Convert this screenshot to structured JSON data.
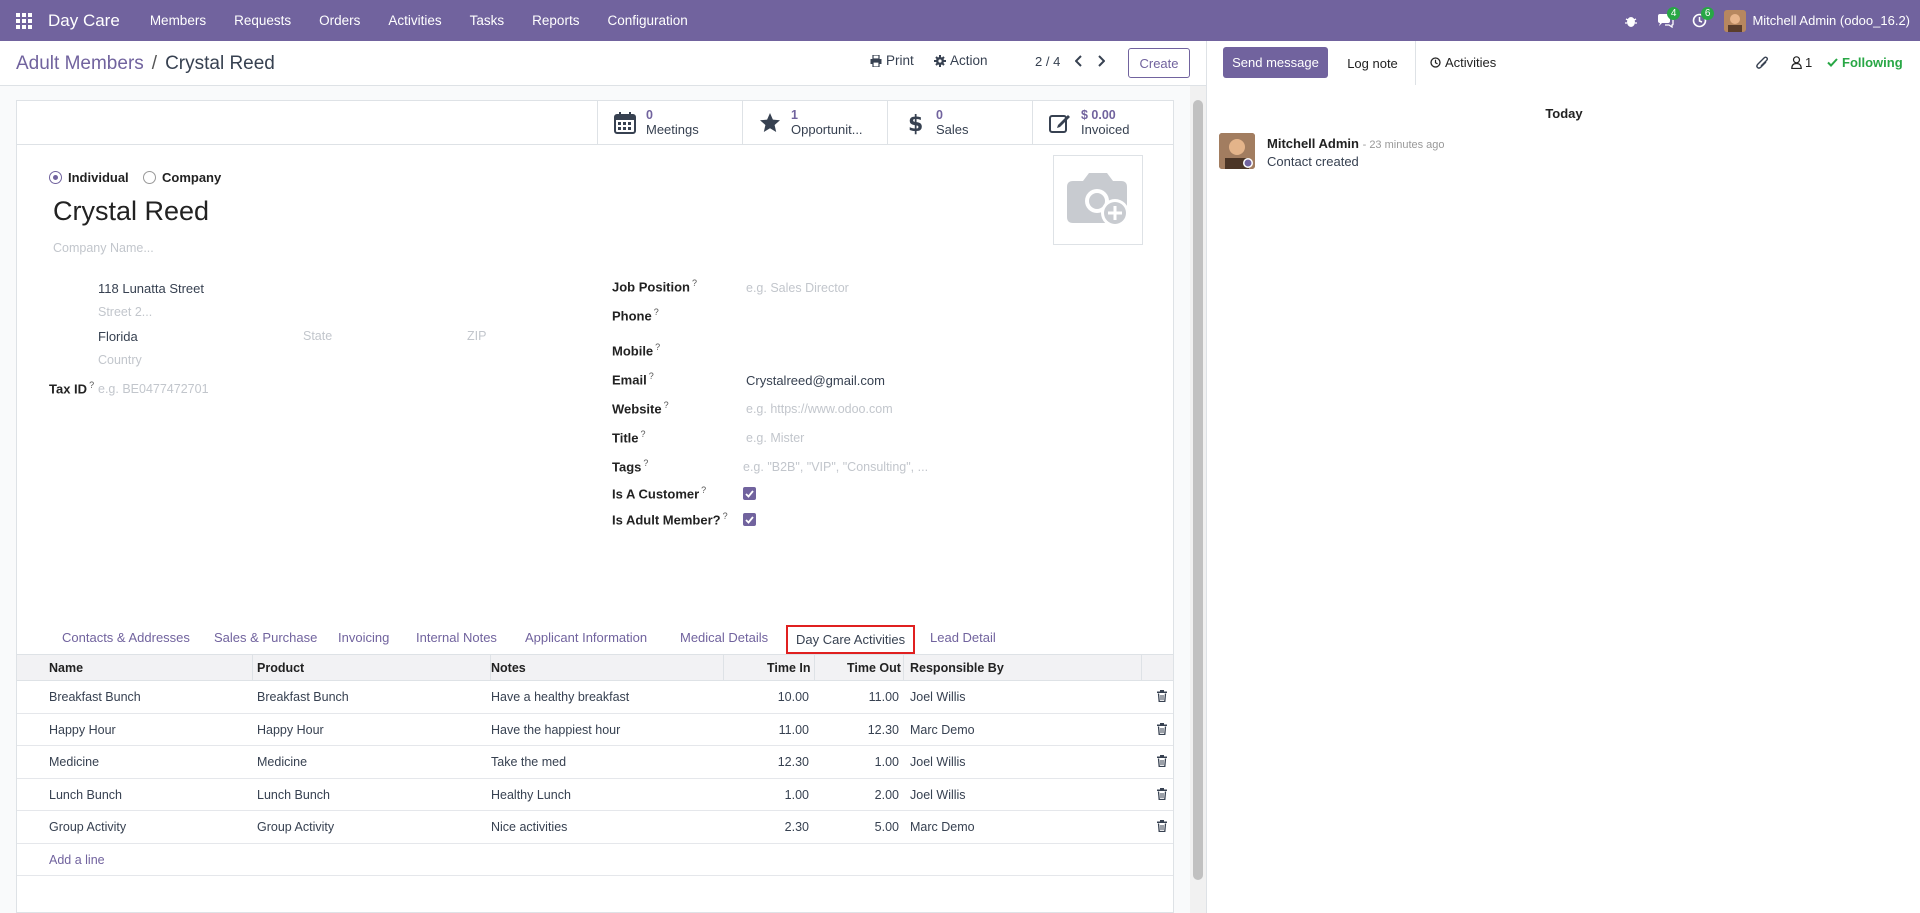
{
  "navbar": {
    "brand": "Day Care",
    "menu": [
      "Members",
      "Requests",
      "Orders",
      "Activities",
      "Tasks",
      "Reports",
      "Configuration"
    ],
    "messages_badge": "4",
    "activities_badge": "6",
    "user": "Mitchell Admin (odoo_16.2)"
  },
  "control": {
    "breadcrumb_parent": "Adult Members",
    "breadcrumb_sep": "/",
    "breadcrumb_current": "Crystal Reed",
    "print_label": "Print",
    "action_label": "Action",
    "pager": "2 / 4",
    "create_label": "Create"
  },
  "stats": [
    {
      "value": "0",
      "label": "Meetings",
      "icon": "calendar-icon"
    },
    {
      "value": "1",
      "label": "Opportunit...",
      "icon": "star-icon"
    },
    {
      "value": "0",
      "label": "Sales",
      "icon": "dollar-icon"
    },
    {
      "value": "$ 0.00",
      "label": "Invoiced",
      "icon": "edit-icon"
    }
  ],
  "form": {
    "radio_individual": "Individual",
    "radio_company": "Company",
    "name": "Crystal Reed",
    "company_placeholder": "Company Name...",
    "street": "118 Lunatta Street",
    "street2_placeholder": "Street 2...",
    "city": "Florida",
    "state_placeholder": "State",
    "zip_placeholder": "ZIP",
    "country_placeholder": "Country",
    "tax_label": "Tax ID",
    "tax_placeholder": "e.g. BE0477472701",
    "job_label": "Job Position",
    "job_placeholder": "e.g. Sales Director",
    "phone_label": "Phone",
    "mobile_label": "Mobile",
    "email_label": "Email",
    "email": "Crystalreed@gmail.com",
    "website_label": "Website",
    "website_placeholder": "e.g. https://www.odoo.com",
    "title_label": "Title",
    "title_placeholder": "e.g. Mister",
    "tags_label": "Tags",
    "tags_placeholder": "e.g. \"B2B\", \"VIP\", \"Consulting\", ...",
    "customer_label": "Is A Customer",
    "adult_label": "Is Adult Member?",
    "help_mark": "?"
  },
  "tabs": [
    "Contacts & Addresses",
    "Sales & Purchase",
    "Invoicing",
    "Internal Notes",
    "Applicant Information",
    "Medical Details",
    "Day Care Activities",
    "Lead Detail"
  ],
  "table": {
    "headers": [
      "Name",
      "Product",
      "Notes",
      "Time In",
      "Time Out",
      "Responsible By"
    ],
    "rows": [
      [
        "Breakfast Bunch",
        "Breakfast Bunch",
        "Have a healthy breakfast",
        "10.00",
        "11.00",
        "Joel Willis"
      ],
      [
        "Happy Hour",
        "Happy Hour",
        "Have the happiest hour",
        "11.00",
        "12.30",
        "Marc Demo"
      ],
      [
        "Medicine",
        "Medicine",
        "Take the med",
        "12.30",
        "1.00",
        "Joel Willis"
      ],
      [
        "Lunch Bunch",
        "Lunch Bunch",
        "Healthy Lunch",
        "1.00",
        "2.00",
        "Joel Willis"
      ],
      [
        "Group Activity",
        "Group Activity",
        "Nice activities",
        "2.30",
        "5.00",
        "Marc Demo"
      ]
    ],
    "add_line": "Add a line"
  },
  "chatter": {
    "send_message": "Send message",
    "log_note": "Log note",
    "activities": "Activities",
    "followers_count": "1",
    "following": "Following",
    "today": "Today",
    "message_author": "Mitchell Admin",
    "message_time": "- 23 minutes ago",
    "message_body": "Contact created"
  }
}
